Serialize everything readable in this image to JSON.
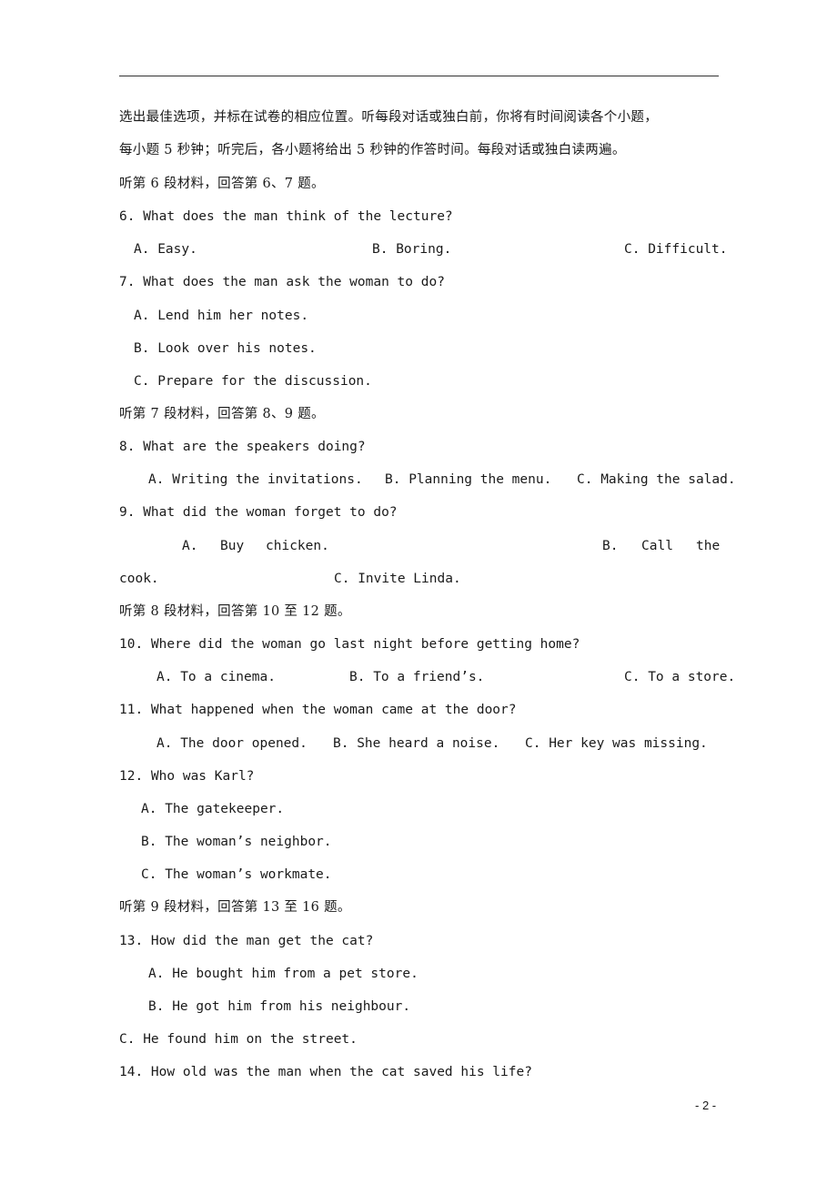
{
  "instructions": {
    "line1": "选出最佳选项，并标在试卷的相应位置。听每段对话或独白前，你将有时间阅读各个小题，",
    "line2": "每小题 5 秒钟；听完后，各小题将给出 5 秒钟的作答时间。每段对话或独白读两遍。"
  },
  "sections": [
    {
      "heading": "听第 6 段材料，回答第 6、7 题。",
      "questions": [
        {
          "stem": "6. What does the man think of the lecture?",
          "options": [
            "A. Easy.",
            "B. Boring.",
            "C. Difficult."
          ]
        },
        {
          "stem": "7. What does the man ask the woman to do?",
          "options": [
            "A. Lend him her notes.",
            "B. Look over his notes.",
            "C. Prepare for the discussion."
          ]
        }
      ]
    },
    {
      "heading": "听第 7 段材料，回答第 8、9 题。",
      "questions": [
        {
          "stem": "8. What are the speakers doing?",
          "options": [
            "A. Writing the invitations.",
            "B. Planning the menu.",
            "C. Making the salad."
          ]
        },
        {
          "stem": "9. What did the woman forget to do?",
          "options": [
            "A.",
            "Buy",
            "chicken.",
            "B.",
            "Call",
            "the",
            "cook.",
            "C. Invite Linda."
          ]
        }
      ]
    },
    {
      "heading": "听第 8 段材料，回答第 10 至 12 题。",
      "questions": [
        {
          "stem": "10. Where did the woman go last night before getting home?",
          "options": [
            "A. To a cinema.",
            "B. To a friend’s.",
            "C. To a store."
          ]
        },
        {
          "stem": "11. What happened when the woman came at the door?",
          "options": [
            "A. The door opened.",
            "B. She heard a noise.",
            "C. Her key was missing."
          ]
        },
        {
          "stem": "12. Who was Karl?",
          "options": [
            "A. The gatekeeper.",
            "B. The woman’s neighbor.",
            "C. The woman’s workmate."
          ]
        }
      ]
    },
    {
      "heading": "听第 9 段材料，回答第 13 至 16 题。",
      "questions": [
        {
          "stem": "13. How did the man get the cat?",
          "options": [
            "A. He bought him from a pet store.",
            "B. He got him from his neighbour.",
            "C. He found him on the street."
          ]
        },
        {
          "stem": "14. How old was the man when the cat saved his life?",
          "options": []
        }
      ]
    }
  ],
  "footer": {
    "page_number": "- 2 -"
  }
}
